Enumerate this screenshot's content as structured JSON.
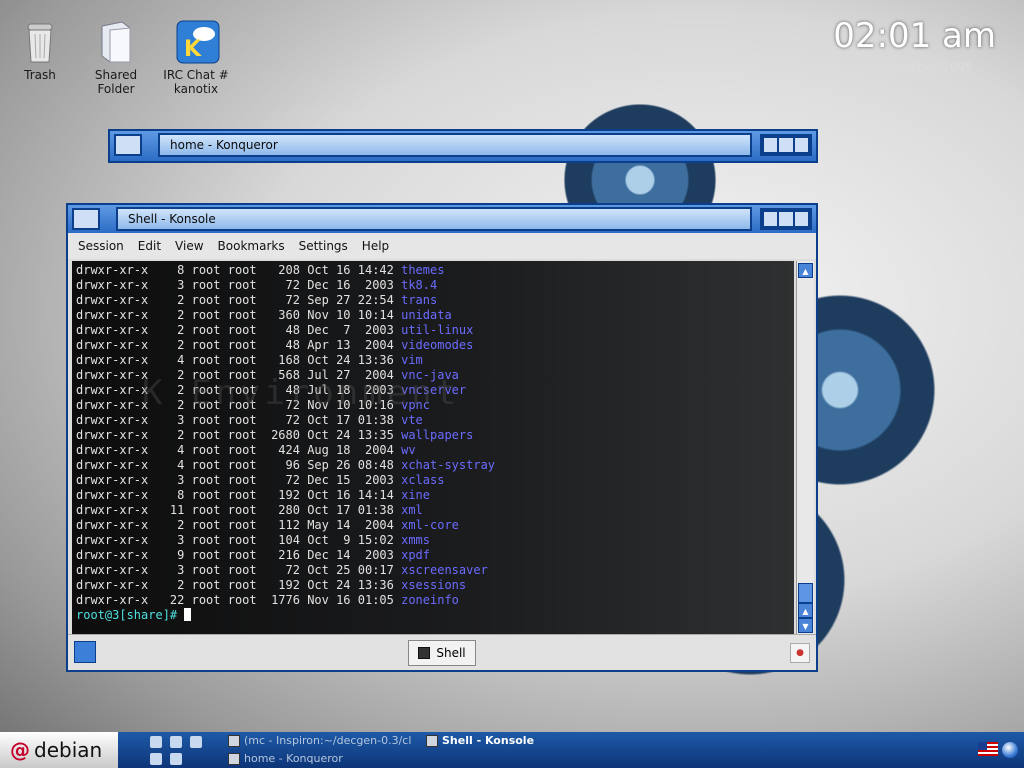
{
  "desktop": {
    "icons": [
      {
        "label_line1": "Trash",
        "label_line2": "",
        "icon": "trash-icon"
      },
      {
        "label_line1": "Shared",
        "label_line2": "Folder",
        "icon": "folder-icon"
      },
      {
        "label_line1": "IRC Chat #",
        "label_line2": "kanotix",
        "icon": "chat-icon"
      }
    ],
    "clock": {
      "time": "02:01 am",
      "date": "25 November 2005"
    },
    "watermark": "K          Environment"
  },
  "konqueror": {
    "title": "home - Konqueror"
  },
  "konsole": {
    "title": "Shell - Konsole",
    "menu": [
      "Session",
      "Edit",
      "View",
      "Bookmarks",
      "Settings",
      "Help"
    ],
    "rows": [
      {
        "perm": "drwxr-xr-x",
        "links": "8",
        "user": "root",
        "group": "root",
        "size": "208",
        "date": "Oct 16 14:42",
        "name": "themes"
      },
      {
        "perm": "drwxr-xr-x",
        "links": "3",
        "user": "root",
        "group": "root",
        "size": "72",
        "date": "Dec 16  2003",
        "name": "tk8.4"
      },
      {
        "perm": "drwxr-xr-x",
        "links": "2",
        "user": "root",
        "group": "root",
        "size": "72",
        "date": "Sep 27 22:54",
        "name": "trans"
      },
      {
        "perm": "drwxr-xr-x",
        "links": "2",
        "user": "root",
        "group": "root",
        "size": "360",
        "date": "Nov 10 10:14",
        "name": "unidata"
      },
      {
        "perm": "drwxr-xr-x",
        "links": "2",
        "user": "root",
        "group": "root",
        "size": "48",
        "date": "Dec  7  2003",
        "name": "util-linux"
      },
      {
        "perm": "drwxr-xr-x",
        "links": "2",
        "user": "root",
        "group": "root",
        "size": "48",
        "date": "Apr 13  2004",
        "name": "videomodes"
      },
      {
        "perm": "drwxr-xr-x",
        "links": "4",
        "user": "root",
        "group": "root",
        "size": "168",
        "date": "Oct 24 13:36",
        "name": "vim"
      },
      {
        "perm": "drwxr-xr-x",
        "links": "2",
        "user": "root",
        "group": "root",
        "size": "568",
        "date": "Jul 27  2004",
        "name": "vnc-java"
      },
      {
        "perm": "drwxr-xr-x",
        "links": "2",
        "user": "root",
        "group": "root",
        "size": "48",
        "date": "Jul 18  2003",
        "name": "vncserver"
      },
      {
        "perm": "drwxr-xr-x",
        "links": "2",
        "user": "root",
        "group": "root",
        "size": "72",
        "date": "Nov 10 10:16",
        "name": "vpnc"
      },
      {
        "perm": "drwxr-xr-x",
        "links": "3",
        "user": "root",
        "group": "root",
        "size": "72",
        "date": "Oct 17 01:38",
        "name": "vte"
      },
      {
        "perm": "drwxr-xr-x",
        "links": "2",
        "user": "root",
        "group": "root",
        "size": "2680",
        "date": "Oct 24 13:35",
        "name": "wallpapers"
      },
      {
        "perm": "drwxr-xr-x",
        "links": "4",
        "user": "root",
        "group": "root",
        "size": "424",
        "date": "Aug 18  2004",
        "name": "wv"
      },
      {
        "perm": "drwxr-xr-x",
        "links": "4",
        "user": "root",
        "group": "root",
        "size": "96",
        "date": "Sep 26 08:48",
        "name": "xchat-systray"
      },
      {
        "perm": "drwxr-xr-x",
        "links": "3",
        "user": "root",
        "group": "root",
        "size": "72",
        "date": "Dec 15  2003",
        "name": "xclass"
      },
      {
        "perm": "drwxr-xr-x",
        "links": "8",
        "user": "root",
        "group": "root",
        "size": "192",
        "date": "Oct 16 14:14",
        "name": "xine"
      },
      {
        "perm": "drwxr-xr-x",
        "links": "11",
        "user": "root",
        "group": "root",
        "size": "280",
        "date": "Oct 17 01:38",
        "name": "xml"
      },
      {
        "perm": "drwxr-xr-x",
        "links": "2",
        "user": "root",
        "group": "root",
        "size": "112",
        "date": "May 14  2004",
        "name": "xml-core"
      },
      {
        "perm": "drwxr-xr-x",
        "links": "3",
        "user": "root",
        "group": "root",
        "size": "104",
        "date": "Oct  9 15:02",
        "name": "xmms"
      },
      {
        "perm": "drwxr-xr-x",
        "links": "9",
        "user": "root",
        "group": "root",
        "size": "216",
        "date": "Dec 14  2003",
        "name": "xpdf"
      },
      {
        "perm": "drwxr-xr-x",
        "links": "3",
        "user": "root",
        "group": "root",
        "size": "72",
        "date": "Oct 25 00:17",
        "name": "xscreensaver"
      },
      {
        "perm": "drwxr-xr-x",
        "links": "2",
        "user": "root",
        "group": "root",
        "size": "192",
        "date": "Oct 24 13:36",
        "name": "xsessions"
      },
      {
        "perm": "drwxr-xr-x",
        "links": "22",
        "user": "root",
        "group": "root",
        "size": "1776",
        "date": "Nov 16 01:05",
        "name": "zoneinfo"
      }
    ],
    "prompt": "root@3[share]# ",
    "tab_label": "Shell"
  },
  "taskbar": {
    "start_label": "debian",
    "tasks": [
      {
        "label": "(mc - Inspiron:~/decgen-0.3/cl",
        "active": false
      },
      {
        "label": "Shell - Konsole",
        "active": true
      },
      {
        "label": "home - Konqueror",
        "active": false
      }
    ]
  },
  "colors": {
    "window_border": "#0b3f8c",
    "titlebar": "#2d6cc6",
    "term_text": "#e2e2e2",
    "dir_name": "#6b6bff",
    "prompt": "#4fe0e0"
  }
}
